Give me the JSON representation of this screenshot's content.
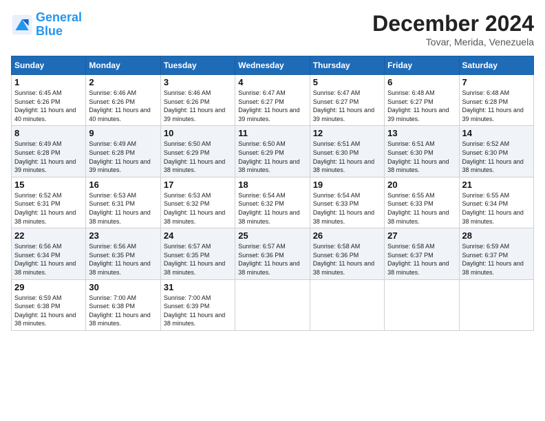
{
  "header": {
    "logo_line1": "General",
    "logo_line2": "Blue",
    "month": "December 2024",
    "location": "Tovar, Merida, Venezuela"
  },
  "weekdays": [
    "Sunday",
    "Monday",
    "Tuesday",
    "Wednesday",
    "Thursday",
    "Friday",
    "Saturday"
  ],
  "weeks": [
    [
      {
        "day": "1",
        "sunrise": "6:45 AM",
        "sunset": "6:26 PM",
        "daylight": "11 hours and 40 minutes."
      },
      {
        "day": "2",
        "sunrise": "6:46 AM",
        "sunset": "6:26 PM",
        "daylight": "11 hours and 40 minutes."
      },
      {
        "day": "3",
        "sunrise": "6:46 AM",
        "sunset": "6:26 PM",
        "daylight": "11 hours and 39 minutes."
      },
      {
        "day": "4",
        "sunrise": "6:47 AM",
        "sunset": "6:27 PM",
        "daylight": "11 hours and 39 minutes."
      },
      {
        "day": "5",
        "sunrise": "6:47 AM",
        "sunset": "6:27 PM",
        "daylight": "11 hours and 39 minutes."
      },
      {
        "day": "6",
        "sunrise": "6:48 AM",
        "sunset": "6:27 PM",
        "daylight": "11 hours and 39 minutes."
      },
      {
        "day": "7",
        "sunrise": "6:48 AM",
        "sunset": "6:28 PM",
        "daylight": "11 hours and 39 minutes."
      }
    ],
    [
      {
        "day": "8",
        "sunrise": "6:49 AM",
        "sunset": "6:28 PM",
        "daylight": "11 hours and 39 minutes."
      },
      {
        "day": "9",
        "sunrise": "6:49 AM",
        "sunset": "6:28 PM",
        "daylight": "11 hours and 39 minutes."
      },
      {
        "day": "10",
        "sunrise": "6:50 AM",
        "sunset": "6:29 PM",
        "daylight": "11 hours and 38 minutes."
      },
      {
        "day": "11",
        "sunrise": "6:50 AM",
        "sunset": "6:29 PM",
        "daylight": "11 hours and 38 minutes."
      },
      {
        "day": "12",
        "sunrise": "6:51 AM",
        "sunset": "6:30 PM",
        "daylight": "11 hours and 38 minutes."
      },
      {
        "day": "13",
        "sunrise": "6:51 AM",
        "sunset": "6:30 PM",
        "daylight": "11 hours and 38 minutes."
      },
      {
        "day": "14",
        "sunrise": "6:52 AM",
        "sunset": "6:30 PM",
        "daylight": "11 hours and 38 minutes."
      }
    ],
    [
      {
        "day": "15",
        "sunrise": "6:52 AM",
        "sunset": "6:31 PM",
        "daylight": "11 hours and 38 minutes."
      },
      {
        "day": "16",
        "sunrise": "6:53 AM",
        "sunset": "6:31 PM",
        "daylight": "11 hours and 38 minutes."
      },
      {
        "day": "17",
        "sunrise": "6:53 AM",
        "sunset": "6:32 PM",
        "daylight": "11 hours and 38 minutes."
      },
      {
        "day": "18",
        "sunrise": "6:54 AM",
        "sunset": "6:32 PM",
        "daylight": "11 hours and 38 minutes."
      },
      {
        "day": "19",
        "sunrise": "6:54 AM",
        "sunset": "6:33 PM",
        "daylight": "11 hours and 38 minutes."
      },
      {
        "day": "20",
        "sunrise": "6:55 AM",
        "sunset": "6:33 PM",
        "daylight": "11 hours and 38 minutes."
      },
      {
        "day": "21",
        "sunrise": "6:55 AM",
        "sunset": "6:34 PM",
        "daylight": "11 hours and 38 minutes."
      }
    ],
    [
      {
        "day": "22",
        "sunrise": "6:56 AM",
        "sunset": "6:34 PM",
        "daylight": "11 hours and 38 minutes."
      },
      {
        "day": "23",
        "sunrise": "6:56 AM",
        "sunset": "6:35 PM",
        "daylight": "11 hours and 38 minutes."
      },
      {
        "day": "24",
        "sunrise": "6:57 AM",
        "sunset": "6:35 PM",
        "daylight": "11 hours and 38 minutes."
      },
      {
        "day": "25",
        "sunrise": "6:57 AM",
        "sunset": "6:36 PM",
        "daylight": "11 hours and 38 minutes."
      },
      {
        "day": "26",
        "sunrise": "6:58 AM",
        "sunset": "6:36 PM",
        "daylight": "11 hours and 38 minutes."
      },
      {
        "day": "27",
        "sunrise": "6:58 AM",
        "sunset": "6:37 PM",
        "daylight": "11 hours and 38 minutes."
      },
      {
        "day": "28",
        "sunrise": "6:59 AM",
        "sunset": "6:37 PM",
        "daylight": "11 hours and 38 minutes."
      }
    ],
    [
      {
        "day": "29",
        "sunrise": "6:59 AM",
        "sunset": "6:38 PM",
        "daylight": "11 hours and 38 minutes."
      },
      {
        "day": "30",
        "sunrise": "7:00 AM",
        "sunset": "6:38 PM",
        "daylight": "11 hours and 38 minutes."
      },
      {
        "day": "31",
        "sunrise": "7:00 AM",
        "sunset": "6:39 PM",
        "daylight": "11 hours and 38 minutes."
      },
      null,
      null,
      null,
      null
    ]
  ]
}
